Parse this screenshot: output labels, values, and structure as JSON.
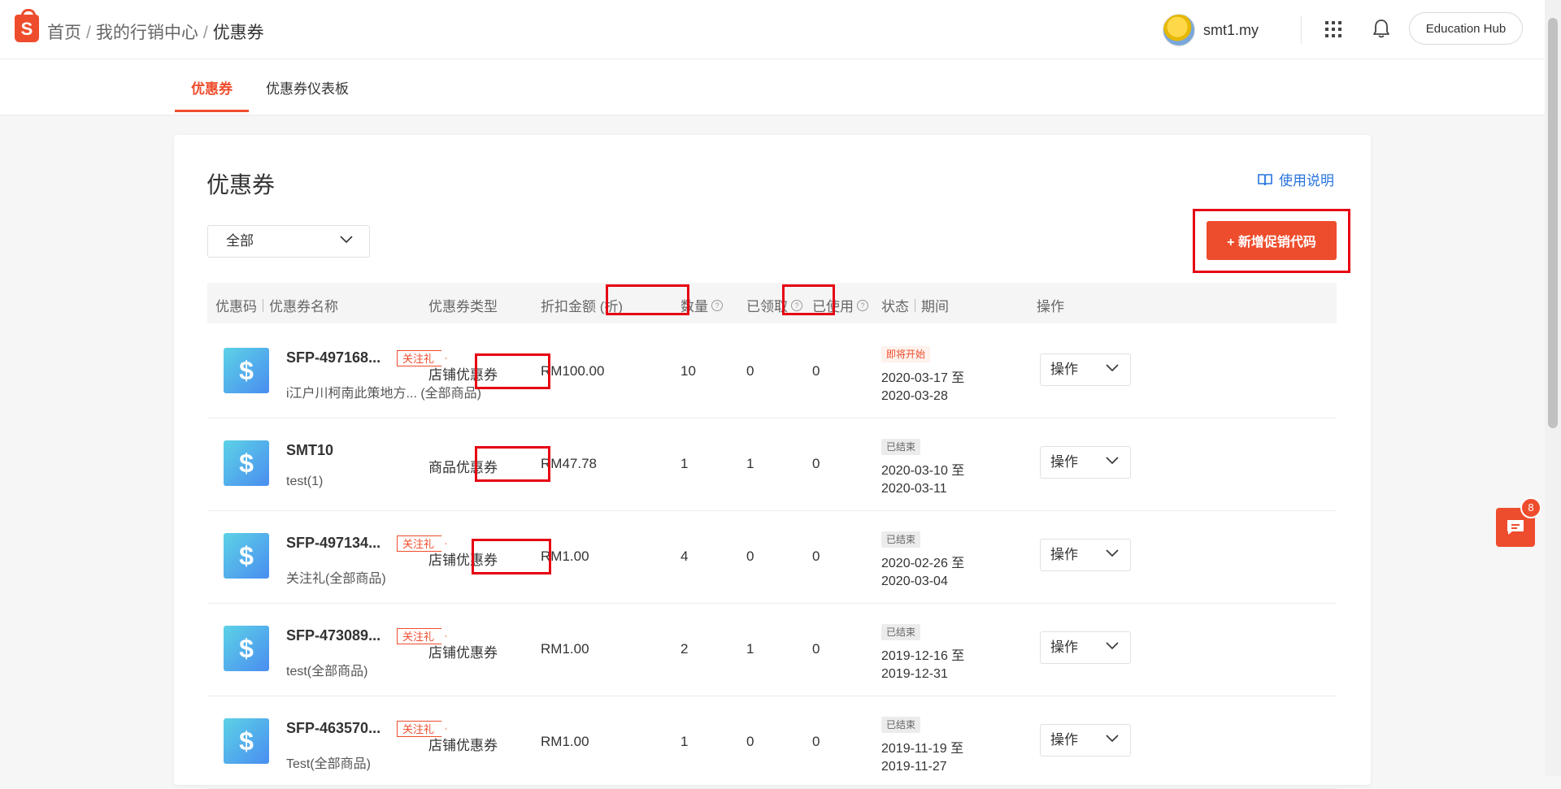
{
  "header": {
    "logo_letter": "S",
    "breadcrumb": [
      "首页",
      "我的行销中心",
      "优惠券"
    ],
    "breadcrumb_sep": "/",
    "username": "smt1.my",
    "education_hub": "Education Hub"
  },
  "tabs": [
    {
      "label": "优惠券",
      "active": true
    },
    {
      "label": "优惠券仪表板",
      "active": false
    }
  ],
  "main": {
    "title": "优惠券",
    "guide_link": "使用说明",
    "filter_value": "全部",
    "add_button": "+ 新增促销代码"
  },
  "table": {
    "columns": {
      "code": "优惠码",
      "name": "优惠券名称",
      "type": "优惠券类型",
      "discount": "折扣金额 (折)",
      "quantity": "数量",
      "claimed": "已领取",
      "used": "已使用",
      "status": "状态",
      "period": "期间",
      "actions": "操作"
    },
    "help_glyph": "?",
    "currency_glyph": "$",
    "rows": [
      {
        "code": "SFP-497168...",
        "tag": "关注礼",
        "name": "i江户川柯南此策地方... (全部商品)",
        "type": "店铺优惠券",
        "discount": "RM100.00",
        "quantity": "10",
        "claimed": "0",
        "used": "0",
        "status": "即将开始",
        "period_start": "2020-03-17 至",
        "period_end": "2020-03-28",
        "action": "操作"
      },
      {
        "code": "SMT10",
        "tag": "",
        "name": "test(1)",
        "type": "商品优惠券",
        "discount": "RM47.78",
        "quantity": "1",
        "claimed": "1",
        "used": "0",
        "status": "已结束",
        "period_start": "2020-03-10 至",
        "period_end": "2020-03-11",
        "action": "操作"
      },
      {
        "code": "SFP-497134...",
        "tag": "关注礼",
        "name": "关注礼(全部商品)",
        "type": "店铺优惠券",
        "discount": "RM1.00",
        "quantity": "4",
        "claimed": "0",
        "used": "0",
        "status": "已结束",
        "period_start": "2020-02-26 至",
        "period_end": "2020-03-04",
        "action": "操作"
      },
      {
        "code": "SFP-473089...",
        "tag": "关注礼",
        "name": "test(全部商品)",
        "type": "店铺优惠券",
        "discount": "RM1.00",
        "quantity": "2",
        "claimed": "1",
        "used": "0",
        "status": "已结束",
        "period_start": "2019-12-16 至",
        "period_end": "2019-12-31",
        "action": "操作"
      },
      {
        "code": "SFP-463570...",
        "tag": "关注礼",
        "name": "Test(全部商品)",
        "type": "店铺优惠券",
        "discount": "RM1.00",
        "quantity": "1",
        "claimed": "0",
        "used": "0",
        "status": "已结束",
        "period_start": "2019-11-19 至",
        "period_end": "2019-11-27",
        "action": "操作"
      }
    ]
  },
  "chat": {
    "badge_count": "8"
  },
  "colors": {
    "brand": "#ee4d2d",
    "link": "#2673dd",
    "highlight": "#e60012"
  }
}
